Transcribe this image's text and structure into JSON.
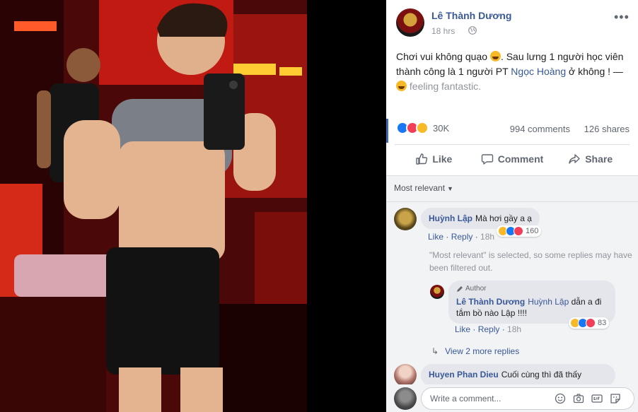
{
  "post": {
    "author": "Lê Thành Dương",
    "time": "18 hrs",
    "text_part1": "Chơi vui không quạo",
    "text_part2": ". Sau lưng 1 người học viên thành công là 1 người PT ",
    "tagged": "Ngọc Hoàng",
    "text_part3": " ở không ! — ",
    "feeling": "feeling fantastic.",
    "reactions_count": "30K",
    "comments_count": "994 comments",
    "shares_count": "126 shares",
    "more_glyph": "•••"
  },
  "actions": {
    "like": "Like",
    "comment": "Comment",
    "share": "Share"
  },
  "comments": {
    "sort_label": "Most relevant",
    "c1": {
      "name": "Huỳnh Lập",
      "text": "Mà hơi gầy a ạ",
      "like": "Like",
      "reply": "Reply",
      "time": "18h",
      "reactions": "160"
    },
    "filtered_note": "\"Most relevant\" is selected, so some replies may have been filtered out.",
    "r1": {
      "badge": "Author",
      "name": "Lê Thành Dương",
      "mention": "Huỳnh Lập",
      "text": " dẫn a đi tắm bồ nào Lập !!!!",
      "like": "Like",
      "reply": "Reply",
      "time": "18h",
      "reactions": "83"
    },
    "view_more": "View 2 more replies",
    "c2": {
      "name": "Huyen Phan Dieu",
      "text": "Cuối cùng thì đã thấy"
    },
    "composer_placeholder": "Write a comment..."
  },
  "colors": {
    "link": "#385898",
    "like_blue": "#1877f2",
    "love_red": "#f33e58",
    "haha_yellow": "#f7b928"
  }
}
